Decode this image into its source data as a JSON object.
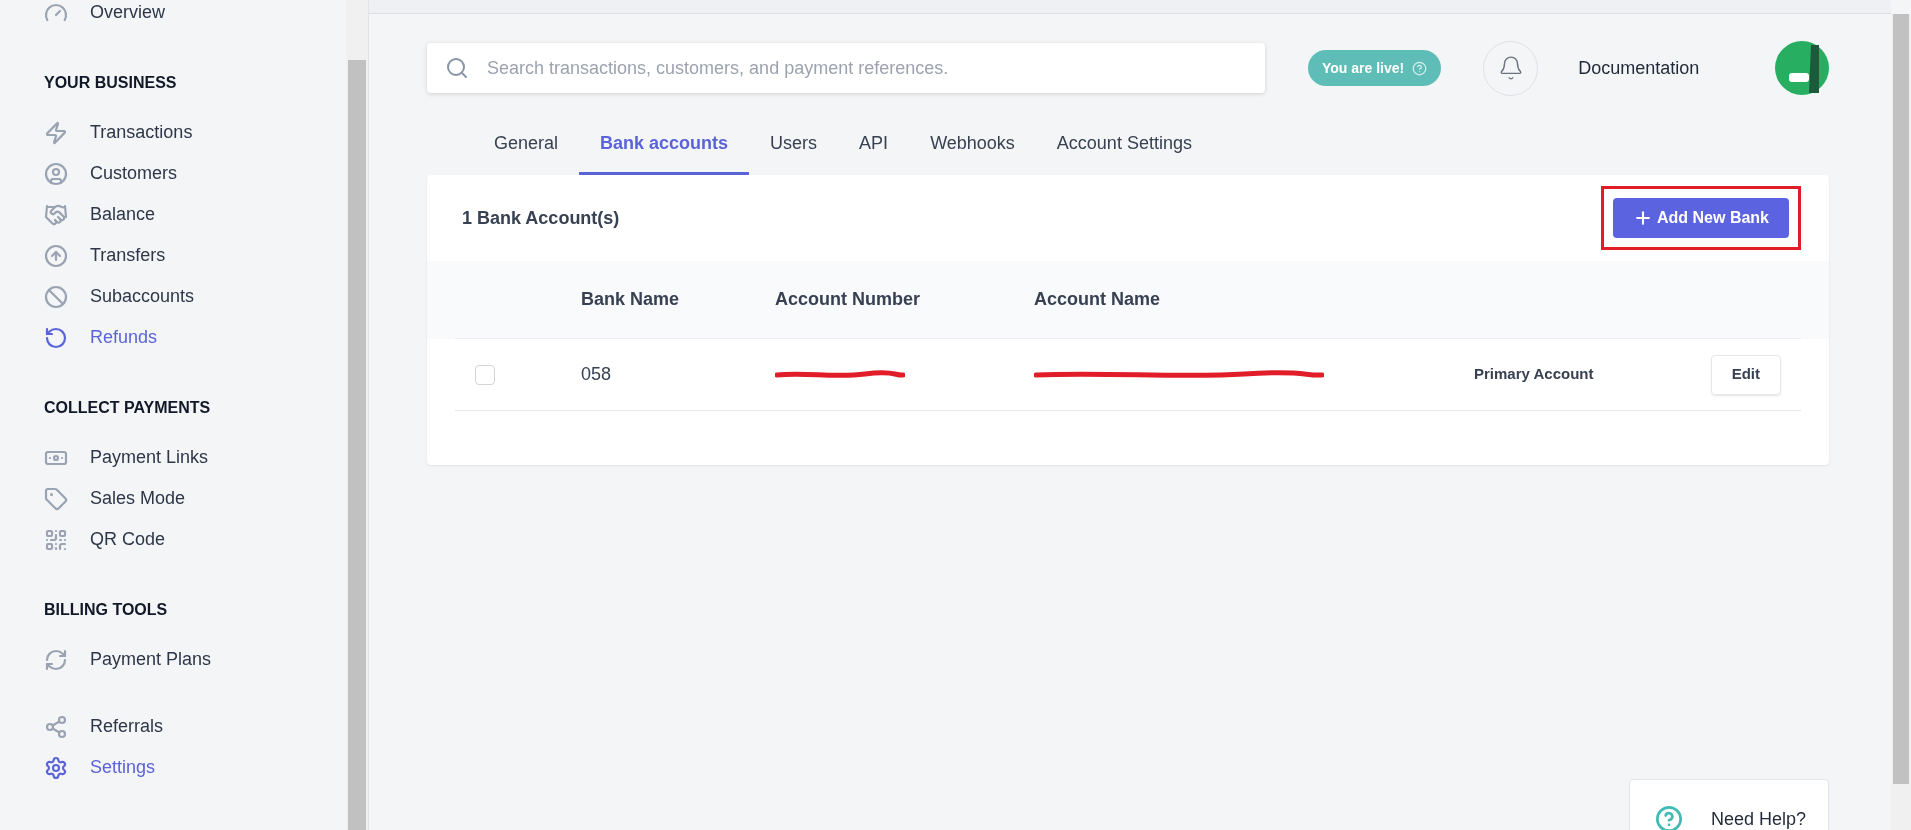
{
  "sidebar": {
    "sections": [
      {
        "items": [
          {
            "label": "Overview",
            "selected": false
          }
        ]
      },
      {
        "heading": "YOUR BUSINESS",
        "items": [
          {
            "label": "Transactions",
            "selected": false
          },
          {
            "label": "Customers",
            "selected": false
          },
          {
            "label": "Balance",
            "selected": false
          },
          {
            "label": "Transfers",
            "selected": false
          },
          {
            "label": "Subaccounts",
            "selected": false
          },
          {
            "label": "Refunds",
            "selected": true
          }
        ]
      },
      {
        "heading": "COLLECT PAYMENTS",
        "items": [
          {
            "label": "Payment Links",
            "selected": false
          },
          {
            "label": "Sales Mode",
            "selected": false
          },
          {
            "label": "QR Code",
            "selected": false
          }
        ]
      },
      {
        "heading": "BILLING TOOLS",
        "items": [
          {
            "label": "Payment Plans",
            "selected": false
          }
        ]
      },
      {
        "items": [
          {
            "label": "Referrals",
            "selected": false
          },
          {
            "label": "Settings",
            "selected": true
          }
        ]
      }
    ]
  },
  "header": {
    "search": {
      "placeholder": "Search transactions, customers, and payment references."
    },
    "live_badge": "You are live!",
    "docs_link": "Documentation"
  },
  "tabs": [
    {
      "label": "General",
      "selected": false
    },
    {
      "label": "Bank accounts",
      "selected": true
    },
    {
      "label": "Users",
      "selected": false
    },
    {
      "label": "API",
      "selected": false
    },
    {
      "label": "Webhooks",
      "selected": false
    },
    {
      "label": "Account Settings",
      "selected": false
    }
  ],
  "card": {
    "title": "1 Bank Account(s)",
    "add_button": {
      "label": "Add New Bank",
      "highlighted": true
    },
    "table": {
      "columns": [
        "Bank Name",
        "Account Number",
        "Account Name"
      ],
      "rows": [
        {
          "checked": false,
          "bank_name": "058",
          "account_number_redacted": true,
          "account_name_redacted": true,
          "tag": "Primary Account",
          "action": "Edit"
        }
      ]
    }
  },
  "help": {
    "label": "Need Help?"
  }
}
